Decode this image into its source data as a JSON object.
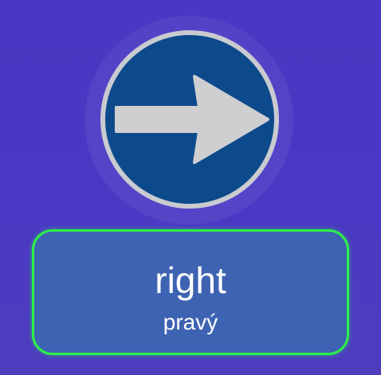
{
  "flashcard": {
    "image_icon": "right-arrow-road-sign-icon",
    "word": "right",
    "translation": "pravý"
  },
  "colors": {
    "background": "#4a38c2",
    "sign_blue": "#0d4a8c",
    "sign_rim": "#c9cbd0",
    "arrow": "#cfcfd1",
    "card_fill": "#3e63b2",
    "card_border": "#2df04a",
    "text": "#ffffff"
  }
}
